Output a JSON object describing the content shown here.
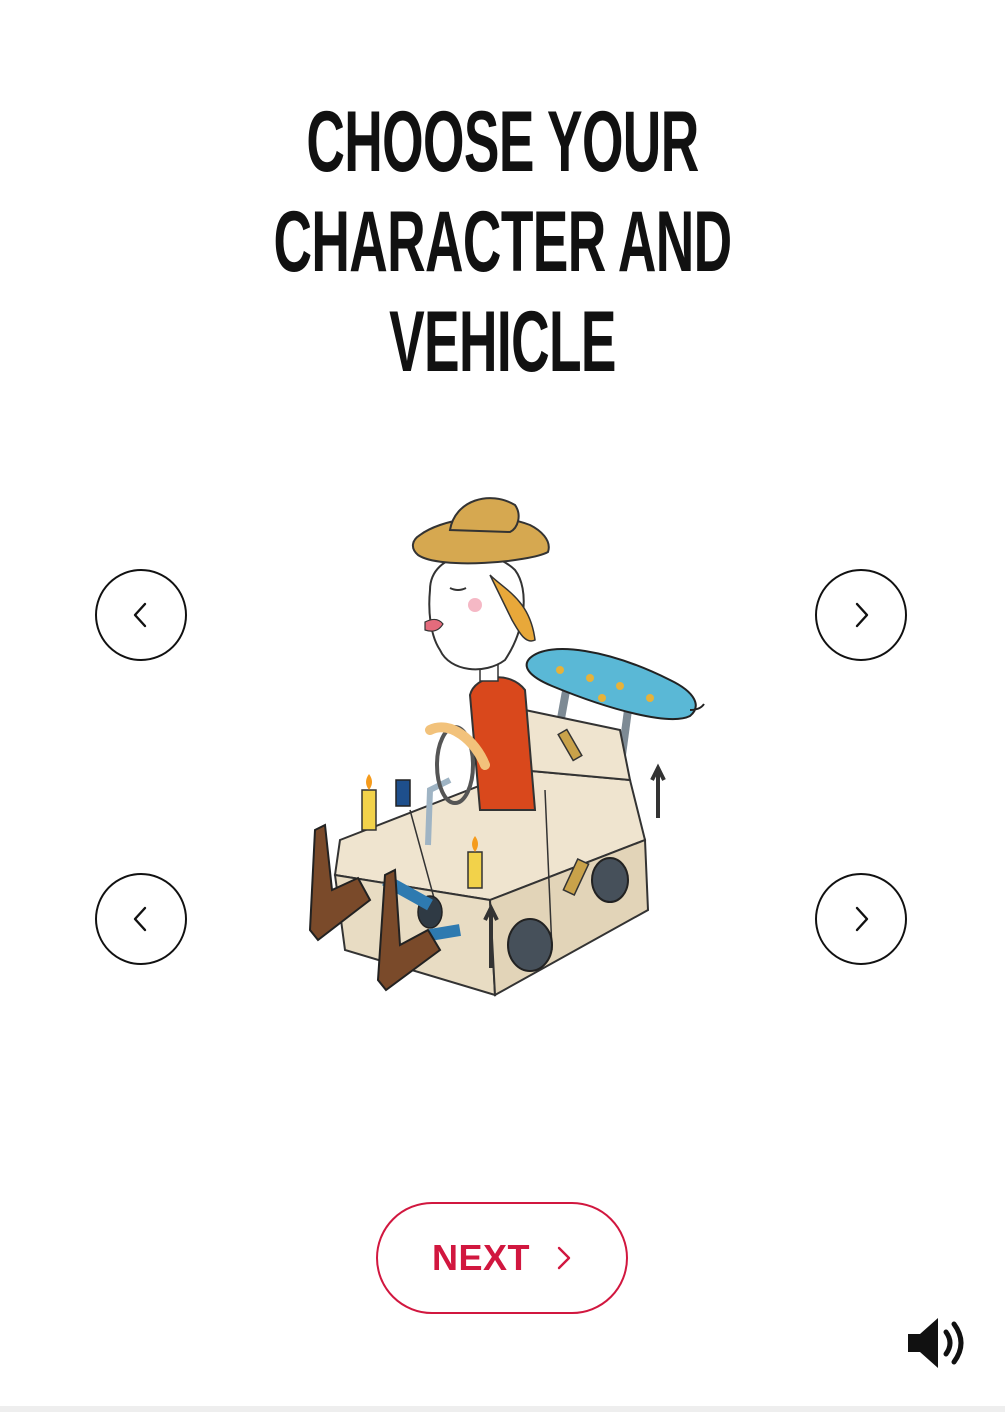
{
  "header": {
    "title_line1": "CHOOSE YOUR CHARACTER AND",
    "title_line2": "VEHICLE"
  },
  "selector": {
    "character_prev_icon": "chevron-left-icon",
    "character_next_icon": "chevron-right-icon",
    "vehicle_prev_icon": "chevron-left-icon",
    "vehicle_next_icon": "chevron-right-icon",
    "illustration": "cowboy-in-cardboard-box-car-illustration"
  },
  "footer": {
    "next_label": "NEXT",
    "next_icon": "chevron-right-icon",
    "sound_icon": "speaker-on-icon"
  },
  "colors": {
    "accent": "#d1173f",
    "text": "#111111",
    "background": "#ffffff"
  }
}
